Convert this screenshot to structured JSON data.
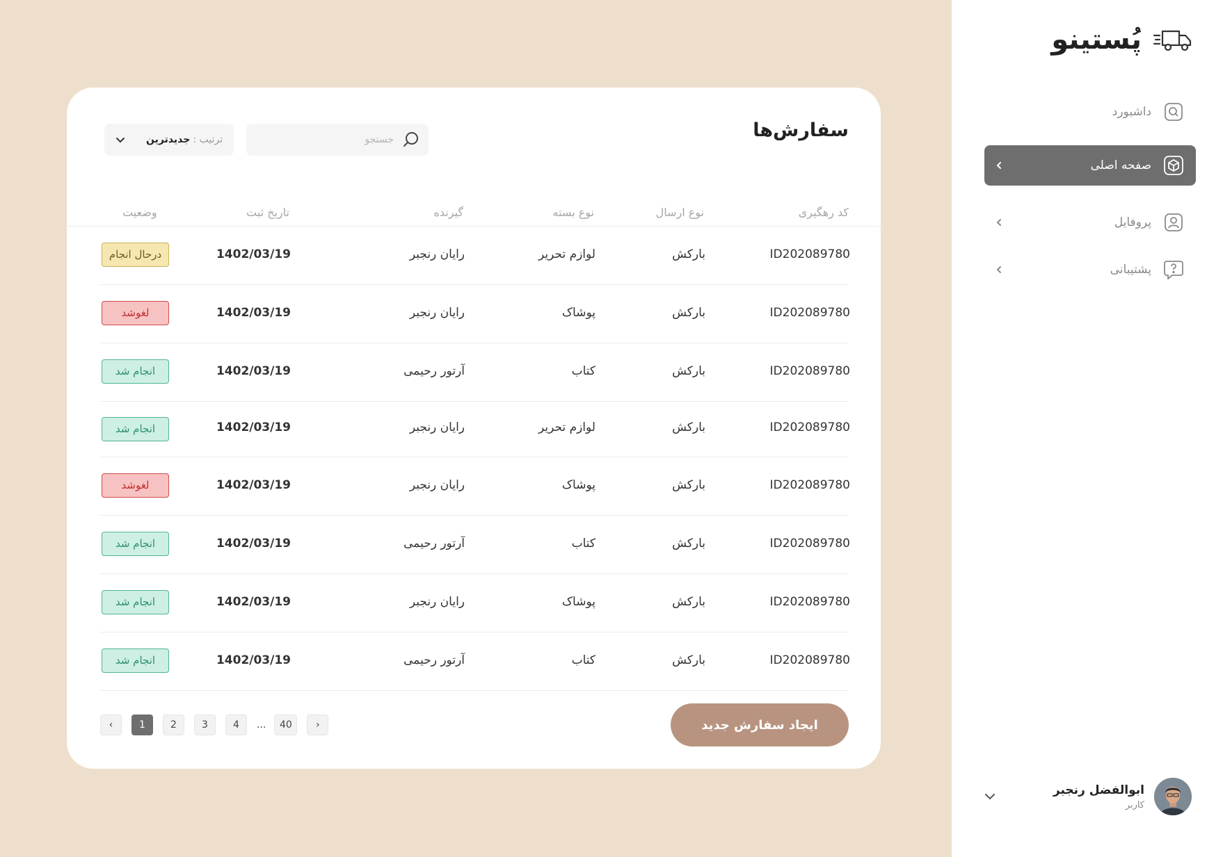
{
  "brand": {
    "name": "پُستینو",
    "icon": "delivery-truck-icon"
  },
  "sidebar": {
    "items": [
      {
        "label": "داشبورد",
        "icon": "dashboard-icon",
        "active": false,
        "has_chevron": false
      },
      {
        "label": "صفحه اصلی",
        "icon": "box-icon",
        "active": true,
        "has_chevron": true
      },
      {
        "label": "پروفایل",
        "icon": "profile-icon",
        "active": false,
        "has_chevron": true
      },
      {
        "label": "پشتیبانی",
        "icon": "support-icon",
        "active": false,
        "has_chevron": true
      }
    ]
  },
  "user": {
    "name": "ابوالفضل  رنجبر",
    "role": "کاربر"
  },
  "orders": {
    "title": "سفارش‌ها",
    "search": {
      "placeholder": "جستجو",
      "value": ""
    },
    "sort": {
      "label": "ترتیب :",
      "value": "جدیدترین"
    },
    "columns": {
      "code": "کد رهگیری",
      "ship": "نوع ارسال",
      "pack": "نوع بسته",
      "recv": "گیرنده",
      "date": "تاریخ ثبت",
      "status": "وضعیت"
    },
    "rows": [
      {
        "code": "ID202089780",
        "ship": "بارکش",
        "pack": "لوازم تحریر",
        "recv": "رایان رنجبر",
        "date": "1402/03/19",
        "status": "درحال انجام",
        "kind": "pending"
      },
      {
        "code": "ID202089780",
        "ship": "بارکش",
        "pack": "پوشاک",
        "recv": "رایان رنجبر",
        "date": "1402/03/19",
        "status": "لغوشد",
        "kind": "cancel"
      },
      {
        "code": "ID202089780",
        "ship": "بارکش",
        "pack": "کتاب",
        "recv": "آرتور رحیمی",
        "date": "1402/03/19",
        "status": "انجام شد",
        "kind": "done"
      },
      {
        "code": "ID202089780",
        "ship": "بارکش",
        "pack": "لوازم تحریر",
        "recv": "رایان رنجبر",
        "date": "1402/03/19",
        "status": "انجام شد",
        "kind": "done"
      },
      {
        "code": "ID202089780",
        "ship": "بارکش",
        "pack": "پوشاک",
        "recv": "رایان رنجبر",
        "date": "1402/03/19",
        "status": "لغوشد",
        "kind": "cancel"
      },
      {
        "code": "ID202089780",
        "ship": "بارکش",
        "pack": "کتاب",
        "recv": "آرتور رحیمی",
        "date": "1402/03/19",
        "status": "انجام شد",
        "kind": "done"
      },
      {
        "code": "ID202089780",
        "ship": "بارکش",
        "pack": "پوشاک",
        "recv": "رایان رنجبر",
        "date": "1402/03/19",
        "status": "انجام شد",
        "kind": "done"
      },
      {
        "code": "ID202089780",
        "ship": "بارکش",
        "pack": "کتاب",
        "recv": "آرتور رحیمی",
        "date": "1402/03/19",
        "status": "انجام شد",
        "kind": "done"
      }
    ],
    "new_order_label": "ایجاد  سفارش  جدید",
    "pagination": {
      "prev": "‹",
      "next": "›",
      "pages": [
        "1",
        "2",
        "3",
        "4"
      ],
      "ellipsis": "...",
      "last": "40",
      "current": "1"
    }
  },
  "colors": {
    "background": "#EEDFCC",
    "active_nav": "#6E6E6E",
    "primary_button": "#B89480",
    "status_pending": "#F6E7B0",
    "status_cancel": "#F7C2C2",
    "status_done": "#CDEFE4"
  }
}
